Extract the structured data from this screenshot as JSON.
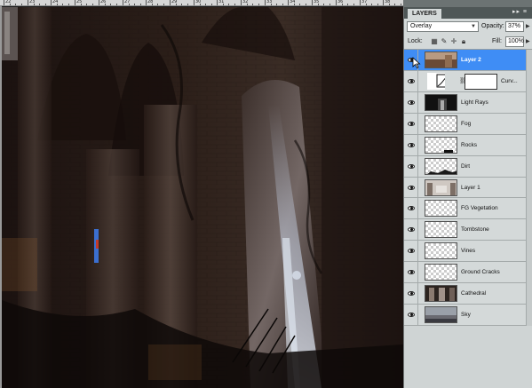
{
  "ruler": {
    "numbers": [
      "22",
      "23",
      "24",
      "25",
      "26",
      "27",
      "28",
      "29",
      "30",
      "31",
      "32",
      "33",
      "34",
      "35",
      "36",
      "37",
      "38"
    ]
  },
  "panel": {
    "tab_label": "LAYERS",
    "tab_buttons": "▸▸ ≡",
    "blend_mode": "Overlay",
    "opacity_label": "Opacity:",
    "opacity_value": "37%",
    "lock_label": "Lock:",
    "fill_label": "Fill:",
    "fill_value": "100%"
  },
  "layers": [
    {
      "name": "Layer 2",
      "selected": true,
      "thumb": "photo-small"
    },
    {
      "name": "Curv...",
      "selected": false,
      "thumb": "curves-adjustment",
      "mask": true
    },
    {
      "name": "Light Rays",
      "selected": false,
      "thumb": "dark-rays"
    },
    {
      "name": "Fog",
      "selected": false,
      "thumb": "transparent"
    },
    {
      "name": "Rocks",
      "selected": false,
      "thumb": "transparent-rocks"
    },
    {
      "name": "Dirt",
      "selected": false,
      "thumb": "transparent-dirt"
    },
    {
      "name": "Layer 1",
      "selected": false,
      "thumb": "photo-ruin"
    },
    {
      "name": "FG Vegetation",
      "selected": false,
      "thumb": "transparent"
    },
    {
      "name": "Tombstone",
      "selected": false,
      "thumb": "transparent"
    },
    {
      "name": "Vines",
      "selected": false,
      "thumb": "transparent"
    },
    {
      "name": "Ground Cracks",
      "selected": false,
      "thumb": "transparent"
    },
    {
      "name": "Cathedral",
      "selected": false,
      "thumb": "photo-cathedral"
    },
    {
      "name": "Sky",
      "selected": false,
      "thumb": "photo-sky"
    }
  ]
}
